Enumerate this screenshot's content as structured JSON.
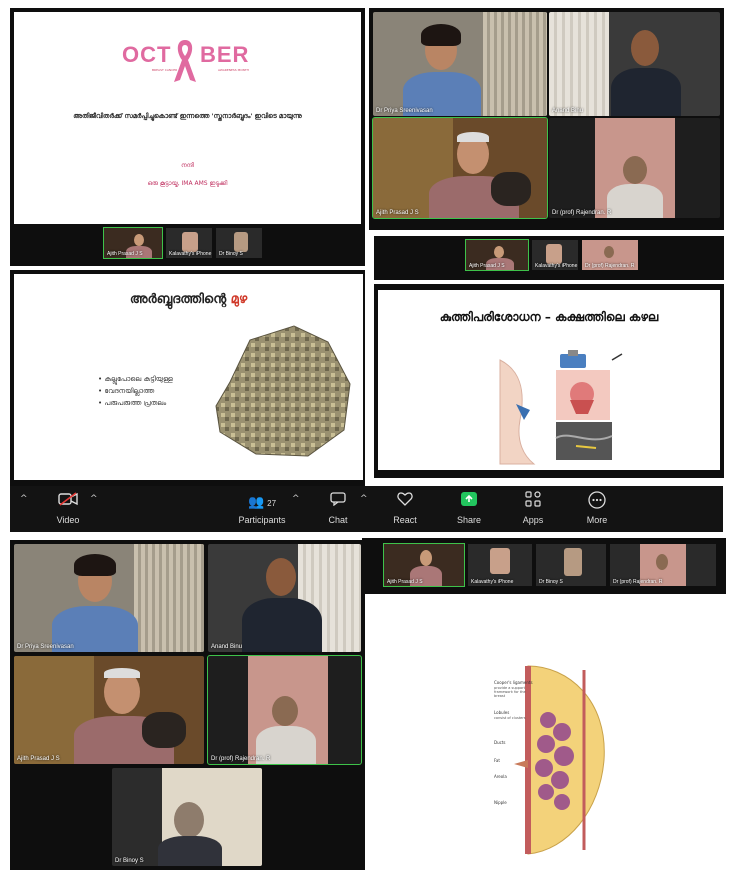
{
  "slide1": {
    "october_left": "OCT",
    "october_right": "BER",
    "sub_tag": "BREAST CANCER",
    "sub_tag2": "AWARENESS MONTH",
    "malayalam_line": "അതിജീവിതർക്ക് സമർപ്പിച്ചുകൊണ്ട് ഇന്നത്തെ 'സ്തനാർബ്ബുദം' ഇവിടെ മായുന്നു",
    "thanks": "നന്ദി",
    "credit": "ഒരു കൂട്ടായ്മ, IMA AMS ഇടുക്കി"
  },
  "top_right_participants": [
    {
      "name": "Dr Priya Sreenivasan"
    },
    {
      "name": "Anand Binu"
    },
    {
      "name": "Ajith Prasad J S"
    },
    {
      "name": "Dr (prof) Rajendran. R"
    }
  ],
  "strip1": [
    {
      "name": "Ajith Prasad J S"
    },
    {
      "name": "Kalavathy's iPhone"
    },
    {
      "name": "Dr Binoy S"
    }
  ],
  "strip2": [
    {
      "name": "Ajith Prasad J S"
    },
    {
      "name": "Kalavathy's iPhone"
    },
    {
      "name": "Dr (prof) Rajendran. R"
    }
  ],
  "slide2": {
    "title_a": "അർബ്ബുദത്തിന്റെ",
    "title_b": "മുഴ",
    "bullets": [
      "കല്ലുപോലെ കട്ടിയുള്ള",
      "വേദനയില്ലാത്ത",
      "പരുപരുത്ത പ്രതലം"
    ]
  },
  "slide3": {
    "title": "കുത്തിപരിശോധന – കക്ഷത്തിലെ കഴല"
  },
  "toolbar": {
    "video": "Video",
    "participants": "Participants",
    "participants_count": "27",
    "chat": "Chat",
    "react": "React",
    "share": "Share",
    "apps": "Apps",
    "more": "More"
  },
  "gallery": [
    {
      "name": "Dr Priya Sreenivasan"
    },
    {
      "name": "Anand Binu"
    },
    {
      "name": "Ajith Prasad J S"
    },
    {
      "name": "Dr (prof) Rajendran. R"
    },
    {
      "name": "Dr Binoy S"
    }
  ],
  "strip3": [
    {
      "name": "Ajith Prasad J S"
    },
    {
      "name": "Kalavathy's iPhone"
    },
    {
      "name": "Dr Binoy S"
    },
    {
      "name": "Dr (prof) Rajendran. R"
    }
  ],
  "diagram": {
    "labels": [
      "Cooper's ligaments",
      "provide a support framework for the breast",
      "Lobules",
      "consist of clusters",
      "Ducts",
      "Fat",
      "Areola",
      "Nipple"
    ]
  },
  "colors": {
    "ribbon": "#e06aa0",
    "active": "#3ec24a",
    "share": "#22c55e"
  }
}
